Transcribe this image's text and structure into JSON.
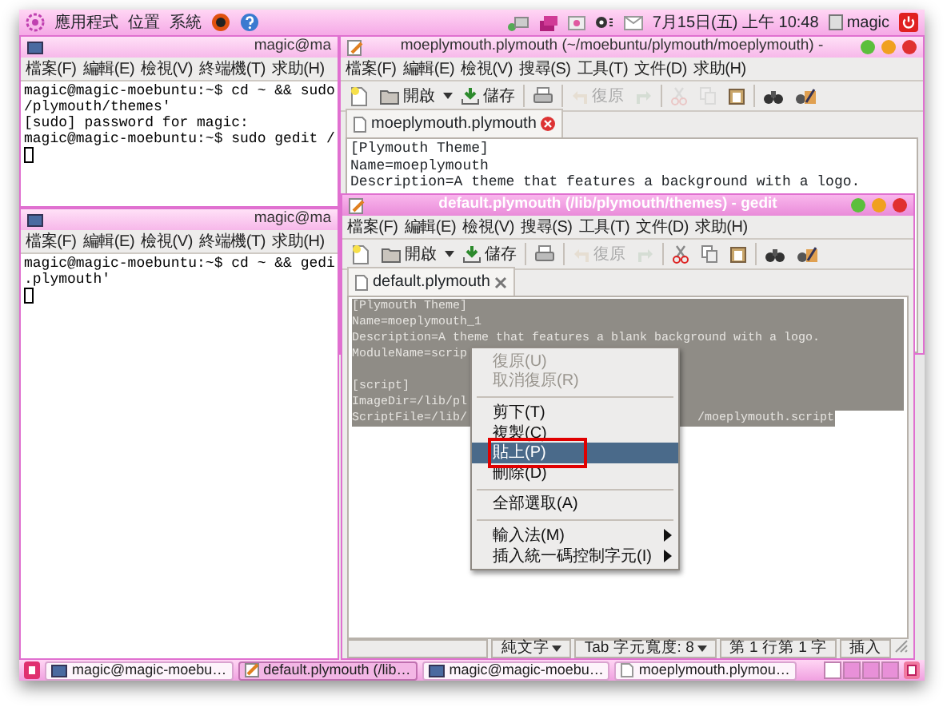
{
  "top_panel": {
    "menus": [
      "應用程式",
      "位置",
      "系統"
    ],
    "clock": "7月15日(五) 上午 10:48",
    "user": "magic"
  },
  "terminal_1": {
    "title": "magic@ma",
    "menu": [
      "檔案(F)",
      "編輯(E)",
      "檢視(V)",
      "終端機(T)",
      "求助(H)"
    ],
    "lines": [
      "magic@magic-moebuntu:~$ cd ~ && sudo",
      "/plymouth/themes'",
      "[sudo] password for magic:",
      "magic@magic-moebuntu:~$ sudo gedit /"
    ]
  },
  "terminal_2": {
    "title": "magic@ma",
    "menu": [
      "檔案(F)",
      "編輯(E)",
      "檢視(V)",
      "終端機(T)",
      "求助(H)"
    ],
    "lines": [
      "magic@magic-moebuntu:~$ cd ~ && gedi",
      ".plymouth'"
    ]
  },
  "gedit_back": {
    "title": "moeplymouth.plymouth (~/moebuntu/plymouth/moeplymouth) -",
    "menu": [
      "檔案(F)",
      "編輯(E)",
      "檢視(V)",
      "搜尋(S)",
      "工具(T)",
      "文件(D)",
      "求助(H)"
    ],
    "toolbar": [
      {
        "kind": "new",
        "disabled": false
      },
      {
        "kind": "open",
        "label": "開啟",
        "disabled": false
      },
      {
        "kind": "save",
        "label": "儲存",
        "disabled": false
      },
      {
        "kind": "separator"
      },
      {
        "kind": "print",
        "disabled": false
      },
      {
        "kind": "separator"
      },
      {
        "kind": "undo",
        "label": "復原",
        "disabled": true
      },
      {
        "kind": "redo",
        "disabled": true
      },
      {
        "kind": "separator"
      },
      {
        "kind": "cut",
        "disabled": true
      },
      {
        "kind": "copy",
        "disabled": true
      },
      {
        "kind": "paste",
        "disabled": false
      },
      {
        "kind": "separator"
      },
      {
        "kind": "find",
        "disabled": false
      },
      {
        "kind": "replace",
        "disabled": false
      }
    ],
    "tab": "moeplymouth.plymouth",
    "lines": [
      "[Plymouth Theme]",
      "Name=moeplymouth",
      "Description=A theme that features a background with a logo."
    ]
  },
  "gedit_front": {
    "title": "default.plymouth (/lib/plymouth/themes) - gedit",
    "menu": [
      "檔案(F)",
      "編輯(E)",
      "檢視(V)",
      "搜尋(S)",
      "工具(T)",
      "文件(D)",
      "求助(H)"
    ],
    "toolbar": [
      {
        "kind": "new",
        "disabled": false
      },
      {
        "kind": "open",
        "label": "開啟",
        "disabled": false
      },
      {
        "kind": "save",
        "label": "儲存",
        "disabled": false
      },
      {
        "kind": "separator"
      },
      {
        "kind": "print",
        "disabled": false
      },
      {
        "kind": "separator"
      },
      {
        "kind": "undo",
        "label": "復原",
        "disabled": true
      },
      {
        "kind": "redo",
        "disabled": true
      },
      {
        "kind": "separator"
      },
      {
        "kind": "cut",
        "disabled": false
      },
      {
        "kind": "copy",
        "disabled": false
      },
      {
        "kind": "paste",
        "disabled": false
      },
      {
        "kind": "separator"
      },
      {
        "kind": "find",
        "disabled": false
      },
      {
        "kind": "replace",
        "disabled": false
      }
    ],
    "tab": "default.plymouth",
    "lines": [
      {
        "kind": "text",
        "text": "[Plymouth Theme]"
      },
      {
        "kind": "text",
        "text": "Name=moeplymouth_1"
      },
      {
        "kind": "text",
        "text": "Description=A theme that features a blank background with a logo."
      },
      {
        "kind": "text",
        "text": "ModuleName=scrip"
      },
      {
        "kind": "blank"
      },
      {
        "kind": "text",
        "text": "[script]"
      },
      {
        "kind": "text",
        "text": "ImageDir=/lib/pl"
      },
      {
        "kind": "split",
        "text": "ScriptFile=/lib/",
        "tail": "/moeplymouth.script"
      }
    ],
    "status": [
      {
        "kind": "blank"
      },
      {
        "kind": "dropdown",
        "text": "純文字"
      },
      {
        "kind": "dropdown",
        "text": "Tab 字元寬度: 8"
      },
      {
        "kind": "label",
        "text": "第 1 行第 1 字"
      },
      {
        "kind": "label",
        "text": "插入"
      }
    ]
  },
  "context_menu": [
    {
      "kind": "item",
      "label": "復原(U)",
      "disabled": true,
      "selected": false,
      "marked": false,
      "submenu": false
    },
    {
      "kind": "item",
      "label": "取消復原(R)",
      "disabled": true,
      "selected": false,
      "marked": false,
      "submenu": false
    },
    {
      "kind": "separator"
    },
    {
      "kind": "item",
      "label": "剪下(T)",
      "disabled": false,
      "selected": false,
      "marked": false,
      "submenu": false
    },
    {
      "kind": "item",
      "label": "複製(C)",
      "disabled": false,
      "selected": false,
      "marked": false,
      "submenu": false
    },
    {
      "kind": "item",
      "label": "貼上(P)",
      "disabled": false,
      "selected": true,
      "marked": true,
      "submenu": false
    },
    {
      "kind": "item",
      "label": "刪除(D)",
      "disabled": false,
      "selected": false,
      "marked": false,
      "submenu": false
    },
    {
      "kind": "separator"
    },
    {
      "kind": "item",
      "label": "全部選取(A)",
      "disabled": false,
      "selected": false,
      "marked": false,
      "submenu": false
    },
    {
      "kind": "separator"
    },
    {
      "kind": "item",
      "label": "輸入法(M)",
      "disabled": false,
      "selected": false,
      "marked": false,
      "submenu": true
    },
    {
      "kind": "item",
      "label": "插入統一碼控制字元(I)",
      "disabled": false,
      "selected": false,
      "marked": false,
      "submenu": true
    }
  ],
  "taskbar": [
    {
      "kind": "terminal",
      "label": "magic@magic-moebu…",
      "selected": false
    },
    {
      "kind": "editor",
      "label": "default.plymouth (/lib…",
      "selected": true
    },
    {
      "kind": "terminal",
      "label": "magic@magic-moebu…",
      "selected": false
    },
    {
      "kind": "document",
      "label": "moeplymouth.plymou…",
      "selected": false
    }
  ]
}
